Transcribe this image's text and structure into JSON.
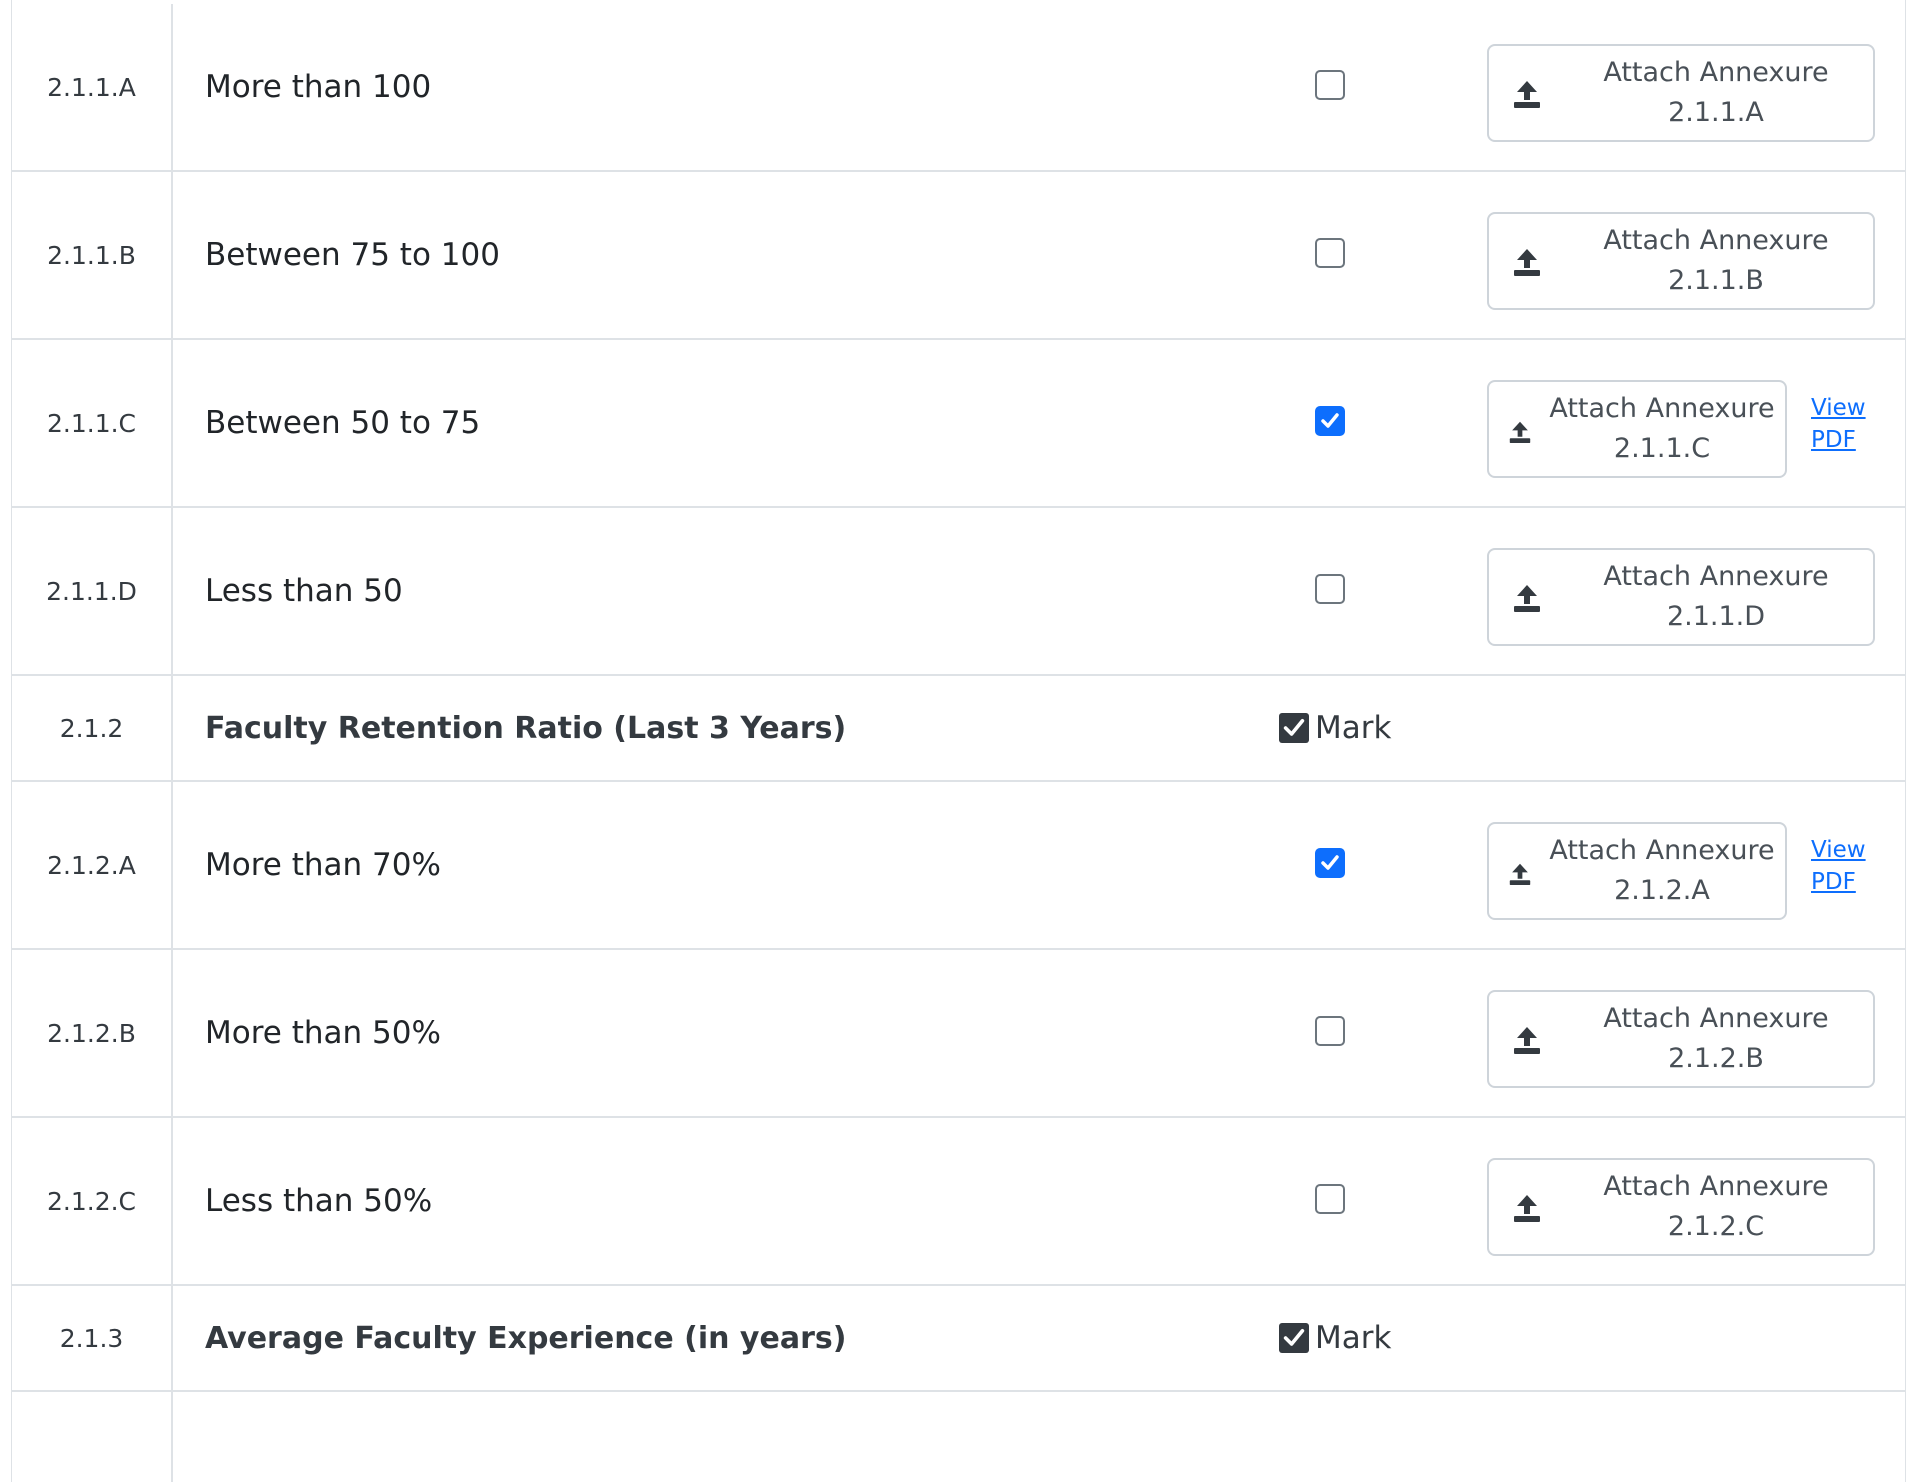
{
  "rows": [
    {
      "code": "2.1.1.A",
      "label": "More than 100",
      "checked": false,
      "attach_line1": "Attach Annexure",
      "attach_line2": "2.1.1.A"
    },
    {
      "code": "2.1.1.B",
      "label": "Between 75 to 100",
      "checked": false,
      "attach_line1": "Attach Annexure",
      "attach_line2": "2.1.1.B"
    },
    {
      "code": "2.1.1.C",
      "label": "Between 50 to 75",
      "checked": true,
      "attach_line1": "Attach Annexure",
      "attach_line2": "2.1.1.C",
      "view_line1": "View",
      "view_line2": "PDF"
    },
    {
      "code": "2.1.1.D",
      "label": "Less than 50",
      "checked": false,
      "attach_line1": "Attach Annexure",
      "attach_line2": "2.1.1.D"
    },
    {
      "code": "2.1.2",
      "label": "Faculty Retention Ratio (Last 3 Years)",
      "mark_label": "Mark"
    },
    {
      "code": "2.1.2.A",
      "label": "More than 70%",
      "checked": true,
      "attach_line1": "Attach Annexure",
      "attach_line2": "2.1.2.A",
      "view_line1": "View",
      "view_line2": "PDF"
    },
    {
      "code": "2.1.2.B",
      "label": "More than 50%",
      "checked": false,
      "attach_line1": "Attach Annexure",
      "attach_line2": "2.1.2.B"
    },
    {
      "code": "2.1.2.C",
      "label": "Less than 50%",
      "checked": false,
      "attach_line1": "Attach Annexure",
      "attach_line2": "2.1.2.C"
    },
    {
      "code": "2.1.3",
      "label": "Average Faculty Experience (in years)",
      "mark_label": "Mark"
    }
  ],
  "icons": {
    "upload": "upload-icon",
    "check": "check-icon"
  },
  "colors": {
    "accent": "#0d6efd",
    "border": "#dee2e6",
    "header_text": "#343a40"
  }
}
